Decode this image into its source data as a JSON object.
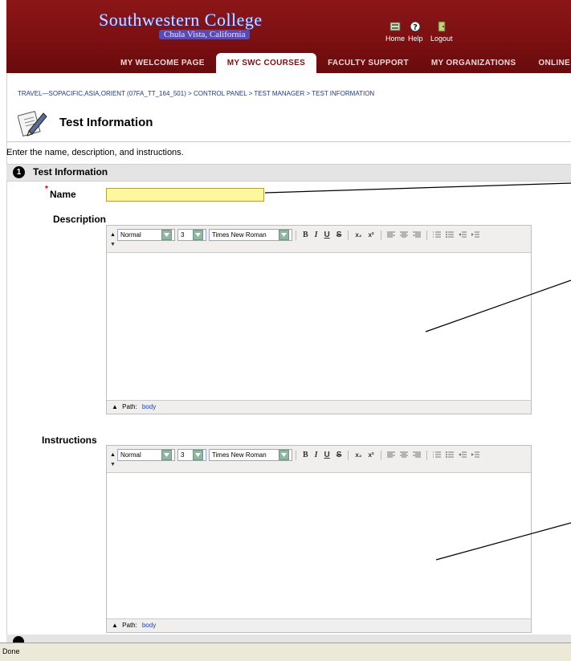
{
  "header": {
    "logo_main": "Southwestern College",
    "logo_sub": "Chula Vista, California",
    "utility": [
      {
        "label": "Home",
        "icon": "home-icon"
      },
      {
        "label": "Help",
        "icon": "help-icon"
      },
      {
        "label": "Logout",
        "icon": "logout-icon"
      }
    ],
    "tabs": [
      "MY WELCOME PAGE",
      "MY SWC COURSES",
      "FACULTY SUPPORT",
      "MY ORGANIZATIONS",
      "ONLINE"
    ],
    "active_tab": "MY SWC COURSES",
    "colors": {
      "brand": "#7b0f12",
      "logo": "#d9d7ff"
    }
  },
  "breadcrumb": "TRAVEL—SOPACIFIC,ASIA,ORIENT (07FA_TT_164_501) > CONTROL PANEL > TEST MANAGER > TEST INFORMATION",
  "page": {
    "title": "Test Information",
    "instructions": "Enter the name, description, and instructions.",
    "section_number": "1",
    "section_title": "Test Information"
  },
  "form": {
    "name_label": "Name",
    "required_mark": "*",
    "name_value": "",
    "description_label": "Description",
    "instructions_label": "Instructions"
  },
  "editor": {
    "style": "Normal",
    "size": "3",
    "font": "Times New Roman",
    "buttons": [
      "B",
      "I",
      "U",
      "S",
      "x₂",
      "x²"
    ],
    "path_label": "Path:",
    "path_value": "body"
  },
  "status": "Done"
}
